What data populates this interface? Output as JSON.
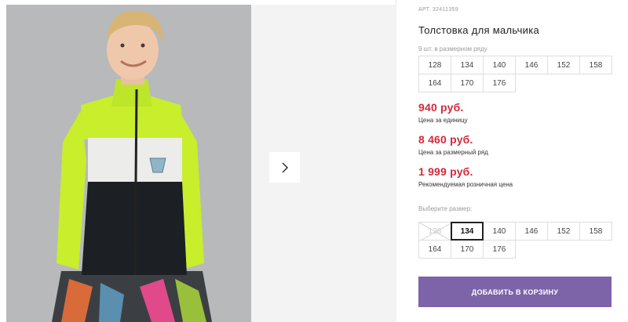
{
  "product": {
    "article": "АРТ. 32411359",
    "title": "Толстовка для мальчика",
    "range_note": "9 шт. в размерном ряду",
    "range_sizes": [
      [
        "128",
        "134",
        "140",
        "146",
        "152",
        "158"
      ],
      [
        "164",
        "170",
        "176"
      ]
    ],
    "prices": {
      "unit_price": "940 руб.",
      "unit_label": "Цена за единицу",
      "range_price": "8 460 руб.",
      "range_label": "Цена за размерный ряд",
      "retail_price": "1 999 руб.",
      "retail_label": "Рекомендуемая розничная цена"
    },
    "choose_label": "Выберите размер:",
    "select_sizes": [
      [
        "128",
        "134",
        "140",
        "146",
        "152",
        "158"
      ],
      [
        "164",
        "170",
        "176"
      ]
    ],
    "selected_size": "134",
    "disabled_size": "128",
    "add_to_cart_label": "ДОБАВИТЬ В КОРЗИНУ"
  },
  "gallery": {
    "next_icon": "chevron-right-icon"
  },
  "colors": {
    "price": "#d42a3a",
    "button": "#7d63a8",
    "jacket_lime": "#c8ee2c",
    "jacket_dark": "#1c1f24"
  }
}
